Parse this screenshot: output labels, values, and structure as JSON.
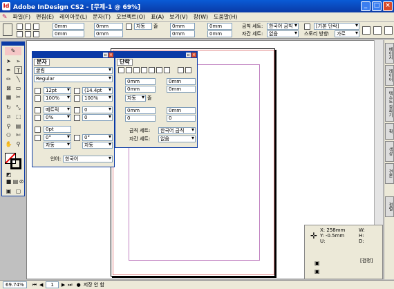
{
  "window": {
    "title": "Adobe InDesign CS2 - [무제-1 @ 69%]",
    "minimize": "_",
    "maximize": "□",
    "close": "×"
  },
  "menu": [
    "파일(F)",
    "편집(E)",
    "레이아웃(L)",
    "문자(T)",
    "오브젝트(O)",
    "표(A)",
    "보기(V)",
    "창(W)",
    "도움말(H)"
  ],
  "control": {
    "indent1": "0mm",
    "indent2": "0mm",
    "indent3": "0mm",
    "indent4": "0mm",
    "space_before": "0mm",
    "space_after": "0mm",
    "space3": "0mm",
    "space4": "0mm",
    "auto": "자동",
    "zul": "줄",
    "kinsoku_label": "금칙 세트:",
    "kinsoku_value": "한국어 금칙",
    "mojikumi_label": "자간 세트:",
    "mojikumi_value": "없음",
    "para_style": "[기본 단락]",
    "story_dir_label": "스토리 방향:",
    "story_dir_value": "가로"
  },
  "char_panel": {
    "tab": "문자",
    "font": "굴림",
    "style": "Regular",
    "size": "12pt",
    "leading": "(14.4pt",
    "vscale": "100%",
    "hscale": "100%",
    "kerning": "메트릭",
    "tracking": "0",
    "tsume": "0%",
    "aki": "0",
    "baseline": "0pt",
    "skew": "0°",
    "rotate": "0°",
    "auto1": "자동",
    "auto2": "자동",
    "language_label": "언어:",
    "language": "한국어"
  },
  "para_panel": {
    "tab": "단락",
    "indent_l": "0mm",
    "indent_r": "0mm",
    "first": "0mm",
    "last": "0mm",
    "grid": "자동",
    "zul": "줄",
    "before": "0mm",
    "after": "0mm",
    "drop1": "0",
    "drop2": "0",
    "kinsoku_label": "금칙 세트:",
    "kinsoku_value": "한국어 금칙",
    "mojikumi_label": "자간 세트:",
    "mojikumi_value": "없음"
  },
  "info": {
    "x": "X: 258mm",
    "y": "Y: -0.5mm",
    "u": "U:",
    "w": "W:",
    "h": "H:",
    "d": "D:",
    "swatch": "[검정]"
  },
  "sidebar": [
    "페이지",
    "레이어",
    "텍스트 감싸기",
    "획",
    "색상",
    "견본",
    "정렬"
  ],
  "status": {
    "zoom": "69.74%",
    "page": "1",
    "save": "저장 안 함"
  }
}
